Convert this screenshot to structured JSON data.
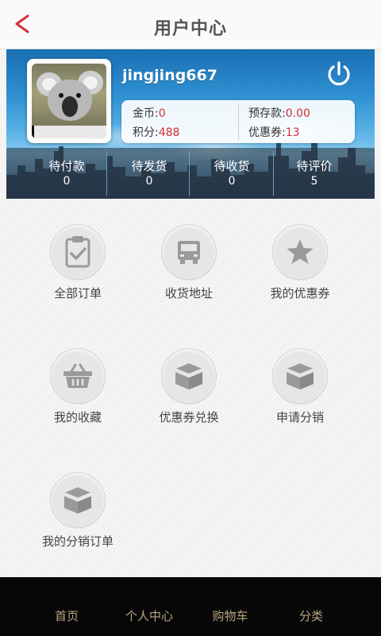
{
  "header": {
    "title": "用户中心",
    "back_icon": "back-chevron-icon"
  },
  "profile": {
    "username": "jingjing667",
    "power_icon": "power-icon",
    "stats": [
      {
        "label": "金币:",
        "value": "0"
      },
      {
        "label": "预存款:",
        "value": "0.00"
      },
      {
        "label": "积分:",
        "value": "488"
      },
      {
        "label": "优惠券:",
        "value": "13"
      }
    ]
  },
  "orders": [
    {
      "label": "待付款",
      "count": "0"
    },
    {
      "label": "待发货",
      "count": "0"
    },
    {
      "label": "待收货",
      "count": "0"
    },
    {
      "label": "待评价",
      "count": "5"
    }
  ],
  "menu": [
    {
      "label": "全部订单",
      "icon": "clipboard-check-icon"
    },
    {
      "label": "收货地址",
      "icon": "truck-icon"
    },
    {
      "label": "我的优惠券",
      "icon": "star-icon"
    },
    {
      "label": "我的收藏",
      "icon": "basket-icon"
    },
    {
      "label": "优惠券兑换",
      "icon": "open-box-icon"
    },
    {
      "label": "申请分销",
      "icon": "open-box-icon"
    },
    {
      "label": "我的分销订单",
      "icon": "open-box-icon"
    }
  ],
  "bottom_nav": [
    {
      "label": "首页"
    },
    {
      "label": "个人中心"
    },
    {
      "label": "购物车"
    },
    {
      "label": "分类"
    }
  ],
  "colors": {
    "accent_red": "#d0313a",
    "nav_text": "#b9a680",
    "banner_blue": "#2d8fd0"
  }
}
